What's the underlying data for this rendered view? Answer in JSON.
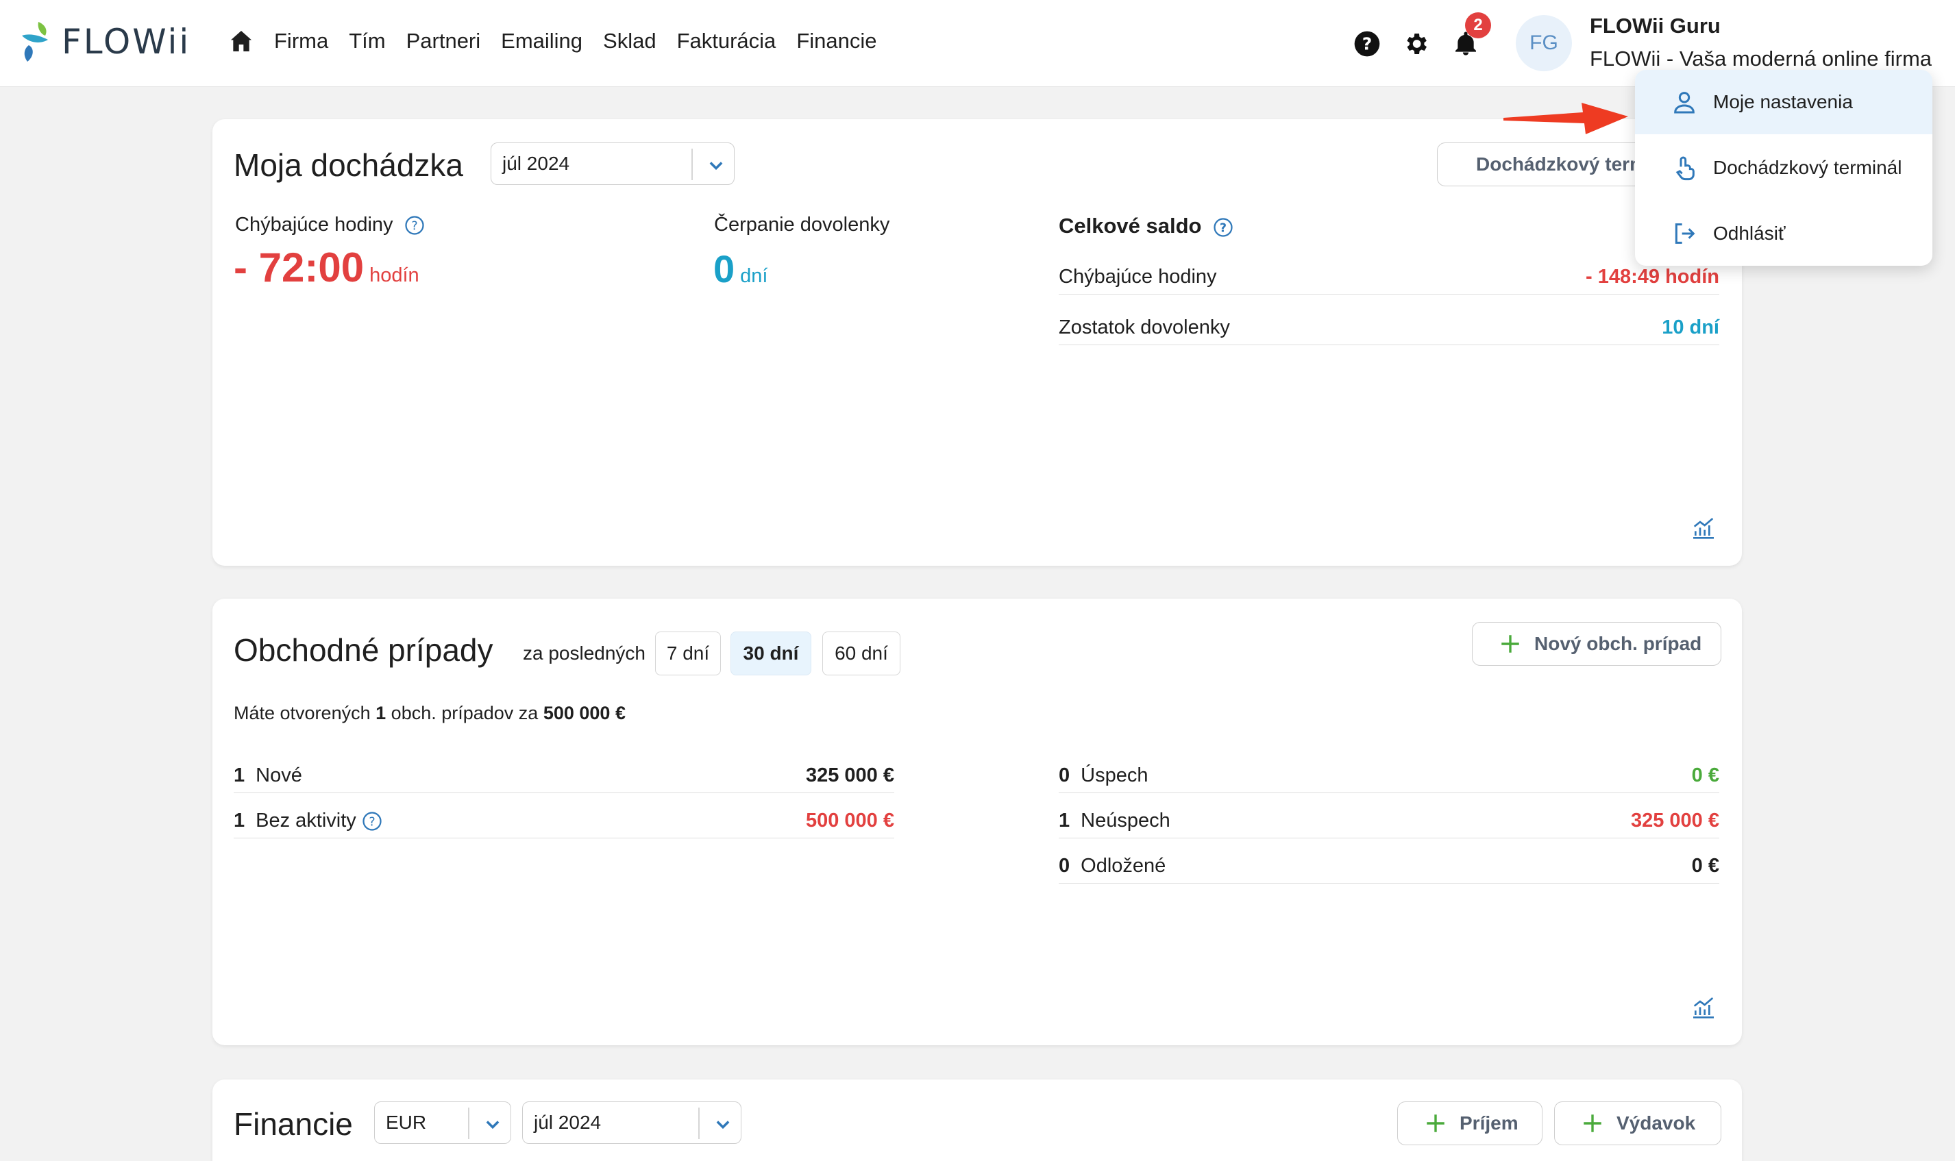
{
  "header": {
    "logo_text": "FLOWii",
    "nav": [
      "Firma",
      "Tím",
      "Partneri",
      "Emailing",
      "Sklad",
      "Fakturácia",
      "Financie"
    ],
    "notification_count": "2",
    "avatar_initials": "FG",
    "user_name": "FLOWii Guru",
    "company_name": "FLOWii - Vaša moderná online firma"
  },
  "user_menu": {
    "items": [
      "Moje nastavenia",
      "Dochádzkový terminál",
      "Odhlásiť"
    ]
  },
  "attendance": {
    "title": "Moja dochádzka",
    "month": "júl 2024",
    "terminal_button": "Dochádzkový terminál",
    "missing_label": "Chýbajúce hodiny",
    "missing_value": "- 72:00",
    "missing_unit": "hodín",
    "vacation_label": "Čerpanie dovolenky",
    "vacation_value": "0",
    "vacation_unit": "dní",
    "balance_title": "Celkové saldo",
    "balance_rows": [
      {
        "label": "Chýbajúce hodiny",
        "value": "- 148:49 hodín"
      },
      {
        "label": "Zostatok dovolenky",
        "value": "10 dní"
      }
    ]
  },
  "deals": {
    "title": "Obchodné prípady",
    "period_label": "za posledných",
    "periods": [
      "7 dní",
      "30 dní",
      "60 dní"
    ],
    "active_period": "30 dní",
    "new_button": "Nový obch. prípad",
    "summary_prefix": "Máte otvorených",
    "summary_count": "1",
    "summary_middle": "obch. prípadov za",
    "summary_amount": "500 000 €",
    "left_rows": [
      {
        "count": "1",
        "label": "Nové",
        "value": "325 000 €"
      },
      {
        "count": "1",
        "label": "Bez aktivity",
        "value": "500 000 €"
      }
    ],
    "right_rows": [
      {
        "count": "0",
        "label": "Úspech",
        "value": "0 €"
      },
      {
        "count": "1",
        "label": "Neúspech",
        "value": "325 000 €"
      },
      {
        "count": "0",
        "label": "Odložené",
        "value": "0 €"
      }
    ]
  },
  "finance": {
    "title": "Financie",
    "currency": "EUR",
    "month": "júl 2024",
    "income_button": "Príjem",
    "expense_button": "Výdavok"
  },
  "colors": {
    "red": "#e2403f",
    "teal": "#1aa0c8",
    "green": "#4aaa3b",
    "menu_highlight": "#e9f3fc"
  }
}
